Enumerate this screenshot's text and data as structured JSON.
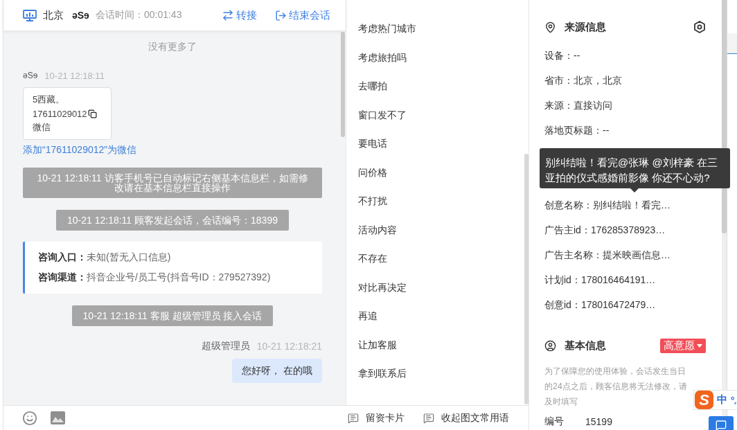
{
  "chat_header": {
    "location": "北京",
    "visitor": "əSɘ",
    "duration": "会话时间：00:01:43",
    "actions": [
      {
        "kind": "transfer",
        "label": "转接"
      },
      {
        "kind": "end",
        "label": "结束会话"
      }
    ]
  },
  "chat": {
    "end_notice": "没有更多了",
    "messages": [
      {
        "kind": "visitor",
        "sender": "əSɘ",
        "time": "10-21 12:18:11",
        "lines": [
          {
            "text": "5西藏。",
            "copyable": false
          },
          {
            "text": "17611029012",
            "copyable": true
          },
          {
            "text": "微信",
            "copyable": false
          }
        ],
        "link": "添加“17611029012”为微信"
      },
      {
        "kind": "system",
        "text": "10-21 12:18:11 访客手机号已自动标记右侧基本信息栏，如需修改请在基本信息栏直接操作"
      },
      {
        "kind": "system",
        "text": "10-21 12:18:11 顾客发起会话，会话编号：18399"
      },
      {
        "kind": "info",
        "rows": [
          {
            "label": "咨询入口：",
            "value": "未知(暂无入口信息)"
          },
          {
            "label": "咨询渠道：",
            "value": "抖音企业号/员工号(抖音号ID：279527392)"
          }
        ]
      },
      {
        "kind": "system",
        "text": "10-21 12:18:11 客服 超级管理员 接入会话"
      },
      {
        "kind": "agent",
        "sender": "超级管理员",
        "time": "10-21 12:18:21",
        "text": "您好呀， 在的哦"
      }
    ]
  },
  "quick_replies": {
    "items": [
      "考虑热门城市",
      "考虑旅拍吗",
      "去哪拍",
      "窗口发不了",
      "要电话",
      "问价格",
      "不打扰",
      "活动内容",
      "不存在",
      "对比再决定",
      "再追",
      "让加客服",
      "拿到联系后"
    ]
  },
  "bottom_bar": {
    "actions": [
      "留资卡片",
      "收起图文常用语"
    ]
  },
  "source_info": {
    "title": "来源信息",
    "rows": [
      {
        "text": "设备：--"
      },
      {
        "text": "省市：北京，北京"
      },
      {
        "text": "来源：直接访问"
      },
      {
        "text": "落地页标题：--"
      },
      {
        "text": "创意名称：别纠结啦！看完…",
        "tooltip": "别纠结啦！看完@张琳 @刘梓豪 在三亚拍的仪式感婚前影像 你还不心动?"
      },
      {
        "text": "广告主id：176285378923…"
      },
      {
        "text": "广告主名称：提米映画信息…"
      },
      {
        "text": "计划id：178016464191…"
      },
      {
        "text": "创意id：178016472479…"
      }
    ]
  },
  "basic_info": {
    "title": "基本信息",
    "intent_badge": "高意愿",
    "notice": "为了保障您的使用体验，会话发生当日的24点之后，顾客信息将无法修改，请及时填写",
    "fields": [
      {
        "label": "编号",
        "value": "15199"
      }
    ]
  },
  "ime_toolbar": {
    "logo": "S",
    "mode": "中"
  }
}
